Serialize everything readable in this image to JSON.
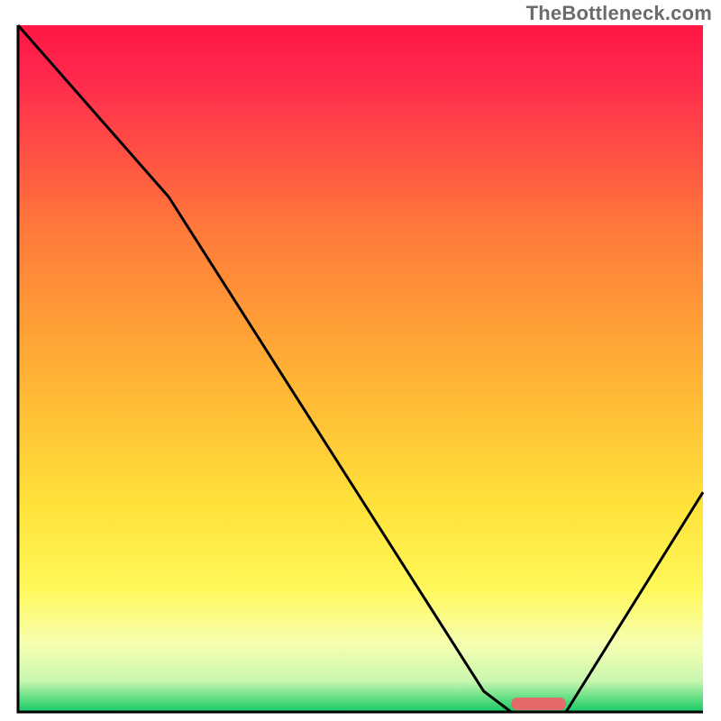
{
  "watermark": "TheBottleneck.com",
  "chart_data": {
    "type": "line",
    "title": "",
    "xlabel": "",
    "ylabel": "",
    "xlim": [
      0,
      100
    ],
    "ylim": [
      0,
      100
    ],
    "series": [
      {
        "name": "bottleneck-curve",
        "x": [
          0,
          22,
          68,
          72,
          80,
          100
        ],
        "y": [
          100,
          75,
          3,
          0,
          0,
          32
        ]
      }
    ],
    "marker": {
      "name": "optimal-range",
      "x_start": 72,
      "x_end": 80,
      "y": 0,
      "color": "#e46a6a"
    },
    "gradient_stops": [
      {
        "offset": 0.0,
        "color": "#ff1744"
      },
      {
        "offset": 0.08,
        "color": "#ff2a4d"
      },
      {
        "offset": 0.3,
        "color": "#ff7a3a"
      },
      {
        "offset": 0.5,
        "color": "#ffb035"
      },
      {
        "offset": 0.7,
        "color": "#ffe23a"
      },
      {
        "offset": 0.82,
        "color": "#fff85a"
      },
      {
        "offset": 0.9,
        "color": "#f7ffb0"
      },
      {
        "offset": 0.955,
        "color": "#c9f7b0"
      },
      {
        "offset": 0.985,
        "color": "#4dd97a"
      },
      {
        "offset": 1.0,
        "color": "#19c96a"
      }
    ]
  }
}
